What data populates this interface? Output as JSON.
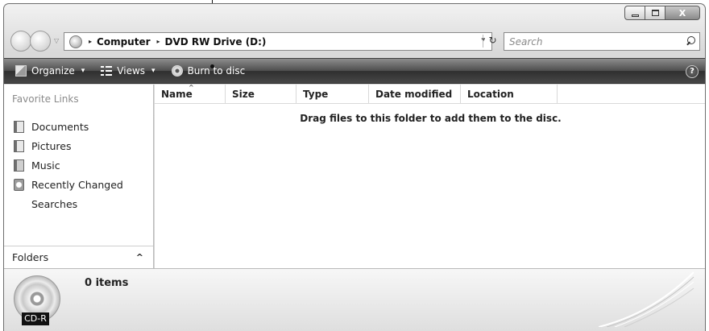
{
  "window": {
    "caption": {
      "minimize_icon": "minimize-icon",
      "maximize_icon": "maximize-icon",
      "close_label": "X"
    }
  },
  "address_bar": {
    "breadcrumbs": [
      "Computer",
      "DVD RW Drive (D:)"
    ],
    "separator": "▸",
    "dropdown": "▾"
  },
  "search": {
    "placeholder": "Search"
  },
  "toolbar": {
    "organize_label": "Organize",
    "views_label": "Views",
    "burn_label": "Burn to disc",
    "caret": "▾",
    "help_label": "?"
  },
  "nav_pane": {
    "title": "Favorite Links",
    "items": [
      {
        "label": "Documents",
        "icon": "documents-icon"
      },
      {
        "label": "Pictures",
        "icon": "pictures-icon"
      },
      {
        "label": "Music",
        "icon": "music-icon"
      },
      {
        "label": "Recently Changed",
        "icon": "recently-changed-icon"
      },
      {
        "label": "Searches",
        "icon": "searches-icon"
      }
    ],
    "folders_label": "Folders",
    "folders_toggle": "^"
  },
  "file_list": {
    "columns": [
      "Name",
      "Size",
      "Type",
      "Date modified",
      "Location"
    ],
    "sort_indicator": "^",
    "empty_message": "Drag files to this folder to add them to the disc."
  },
  "details": {
    "disc_label": "CD-R",
    "item_count": "0 items"
  },
  "colors": {
    "toolbar_dark": "#2f2f2f",
    "accent_text": "#ffffff"
  }
}
